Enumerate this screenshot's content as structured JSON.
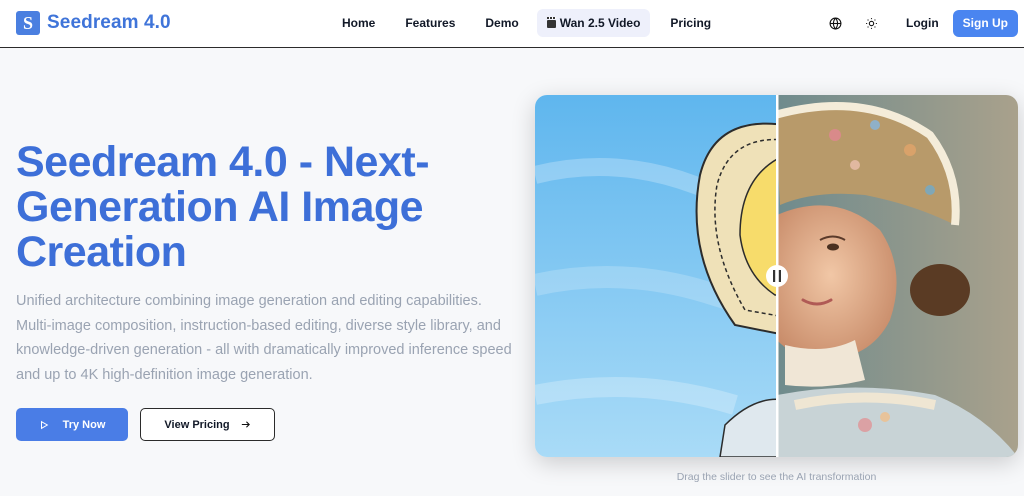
{
  "brand": {
    "name": "Seedream 4.0",
    "logo_letter": "S"
  },
  "nav": {
    "links": [
      {
        "label": "Home"
      },
      {
        "label": "Features"
      },
      {
        "label": "Demo"
      },
      {
        "label": "Wan 2.5 Video",
        "icon": "clapperboard-icon"
      },
      {
        "label": "Pricing"
      }
    ],
    "icons": [
      "globe-icon",
      "sun-icon"
    ],
    "login_label": "Login",
    "signup_label": "Sign Up"
  },
  "hero": {
    "title": "Seedream 4.0 - Next-Generation AI Image Creation",
    "description": "Unified architecture combining image generation and editing capabilities. Multi-image composition, instruction-based editing, diverse style library, and knowledge-driven generation - all with dramatically improved inference speed and up to 4K high-definition image generation.",
    "try_label": "Try Now",
    "pricing_label": "View Pricing"
  },
  "compare": {
    "caption": "Drag the slider to see the AI transformation",
    "slider_position": 0.5
  },
  "colors": {
    "accent": "#4a85f0",
    "title": "#3d6fd8",
    "muted": "#9aa3b2"
  }
}
